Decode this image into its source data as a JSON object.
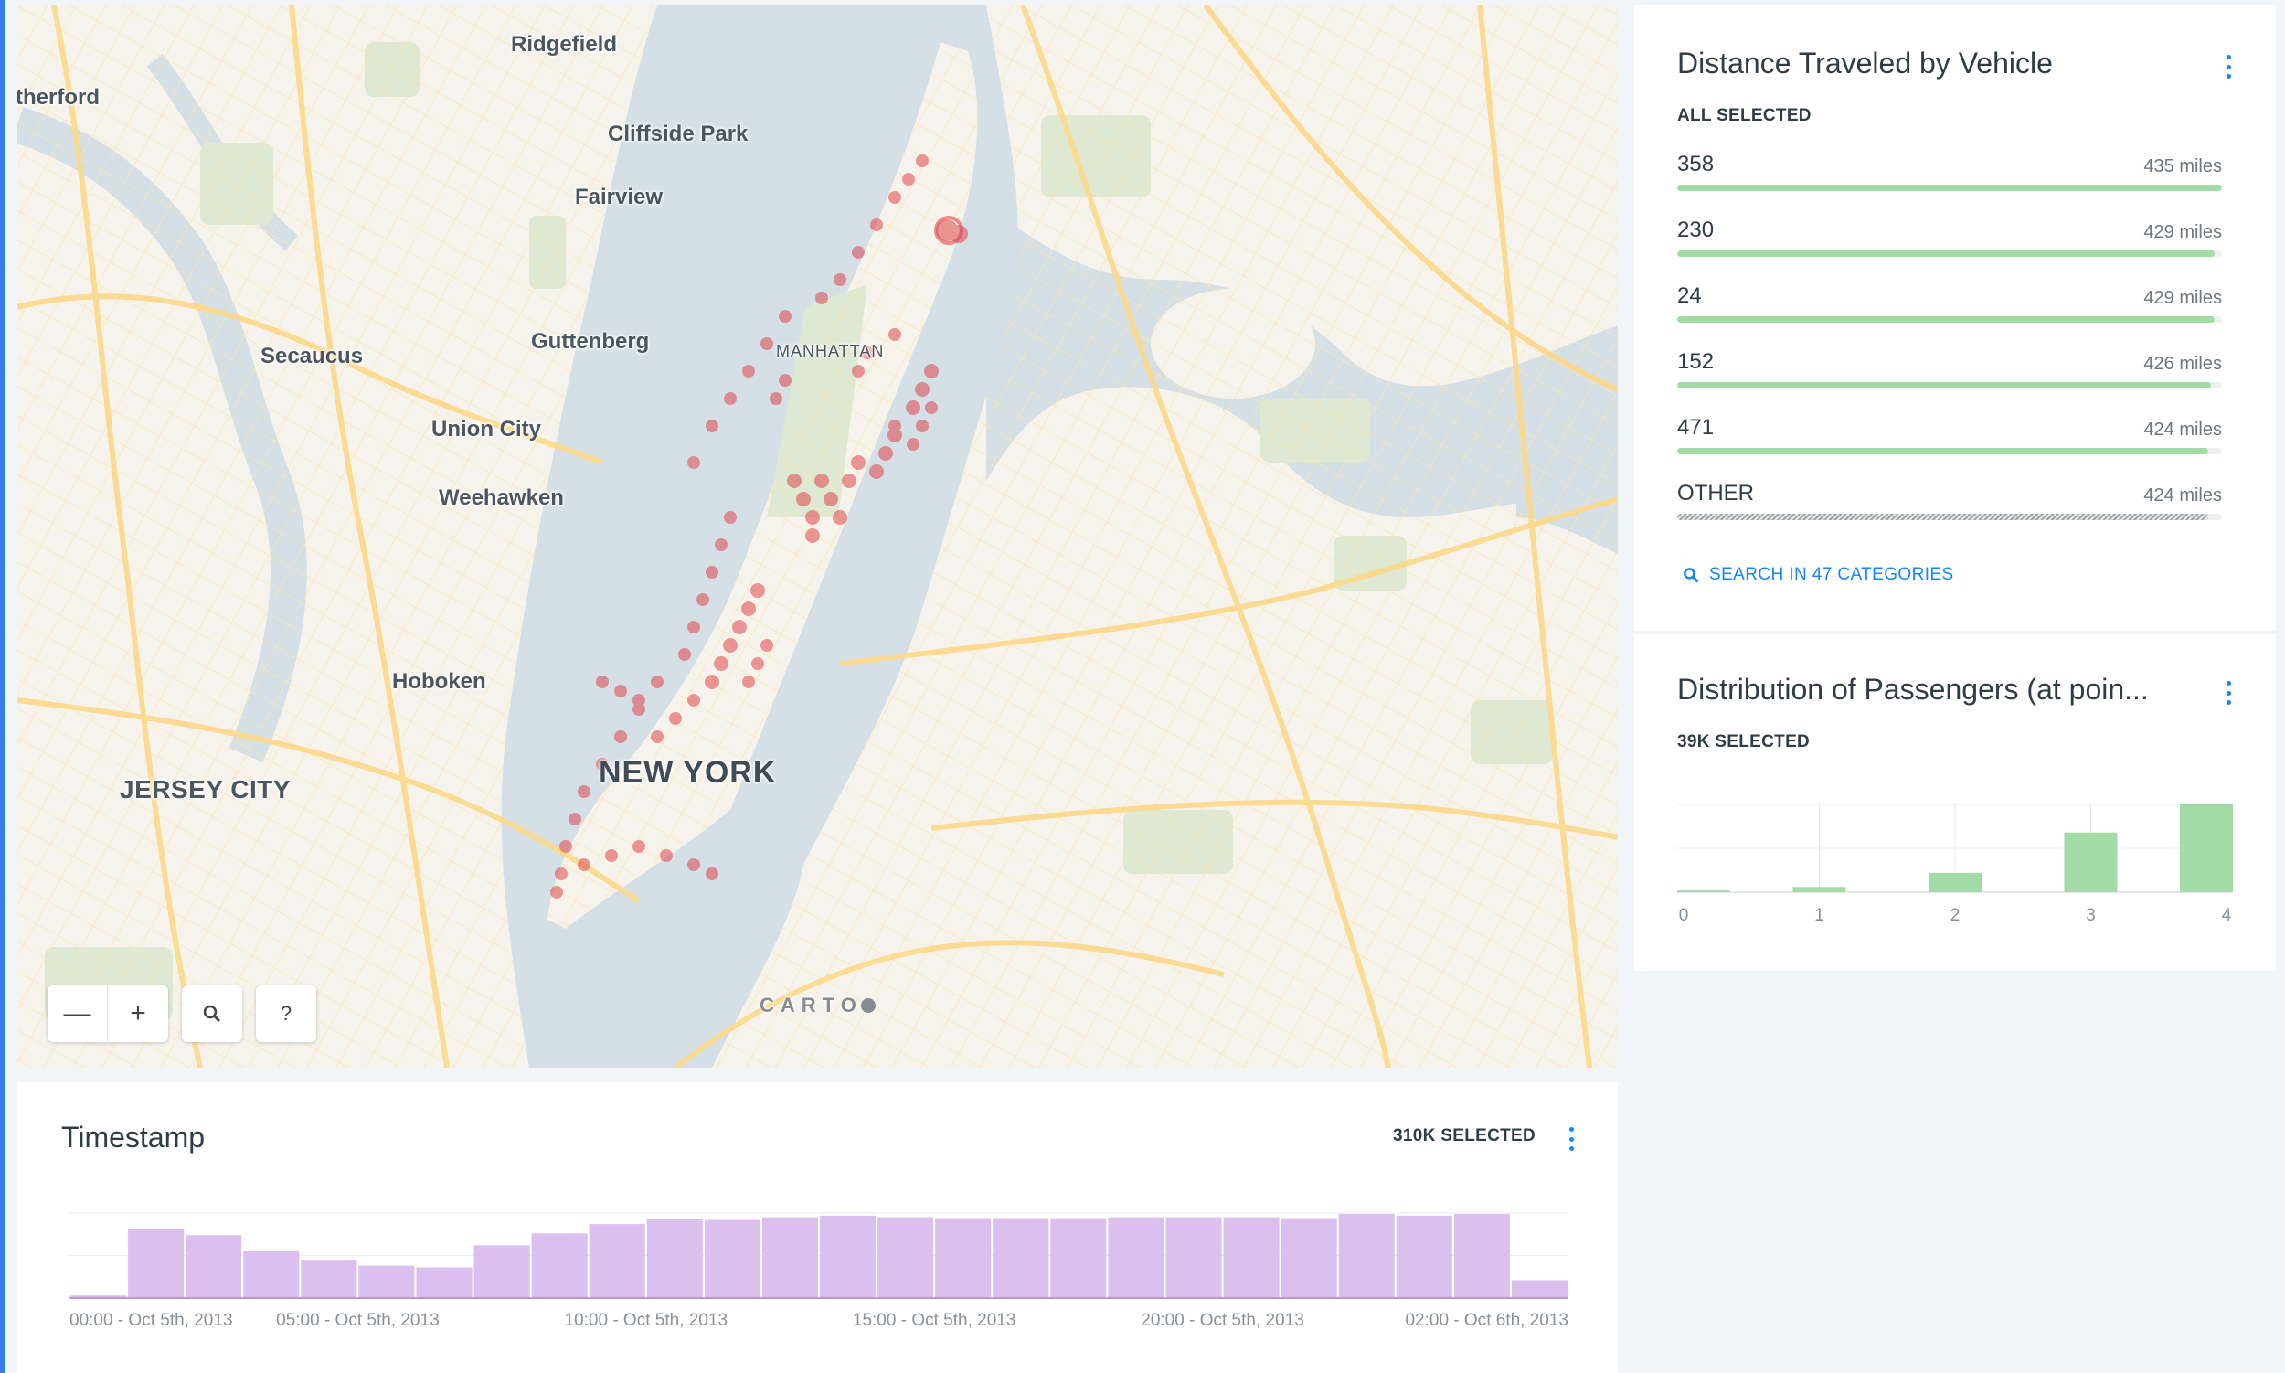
{
  "map": {
    "places": {
      "rutherford": "therford",
      "ridgefield": "Ridgefield",
      "cliffside_park": "Cliffside Park",
      "fairview": "Fairview",
      "secaucus": "Secaucus",
      "guttenberg": "Guttenberg",
      "union_city": "Union City",
      "weehawken": "Weehawken",
      "hoboken": "Hoboken",
      "jersey_city": "JERSEY CITY",
      "new_york": "NEW YORK",
      "manhattan": "MANHATTAN"
    },
    "controls": {
      "zoom_out": "—",
      "zoom_in": "+",
      "search": "🔍",
      "help": "?"
    },
    "attribution": "CARTO",
    "colors": {
      "water": "#d4dfe6",
      "land": "#f6f3ec",
      "park": "#dde9d3",
      "road": "#fce8a8",
      "points": "#e0484c"
    }
  },
  "distance_widget": {
    "title": "Distance Traveled by Vehicle",
    "selection": "ALL SELECTED",
    "menu_icon": "vertical-dots-icon",
    "categories": [
      {
        "name": "358",
        "value_text": "435 miles",
        "value": 435
      },
      {
        "name": "230",
        "value_text": "429 miles",
        "value": 429
      },
      {
        "name": "24",
        "value_text": "429 miles",
        "value": 429
      },
      {
        "name": "152",
        "value_text": "426 miles",
        "value": 426
      },
      {
        "name": "471",
        "value_text": "424 miles",
        "value": 424
      },
      {
        "name": "OTHER",
        "value_text": "424 miles",
        "value": 424
      }
    ],
    "search_link": "SEARCH IN 47 CATEGORIES",
    "bar_color": "#a2dba6"
  },
  "passengers_widget": {
    "title": "Distribution of Passengers (at poin...",
    "selection": "39K SELECTED",
    "menu_icon": "vertical-dots-icon"
  },
  "timestamp_widget": {
    "title": "Timestamp",
    "selection": "310K SELECTED",
    "menu_icon": "vertical-dots-icon"
  },
  "chart_data": [
    {
      "type": "bar",
      "title": "Distribution of Passengers (at poin...",
      "ticks": [
        "0",
        "1",
        "2",
        "3",
        "4"
      ],
      "values": [
        2,
        6,
        22,
        68,
        100
      ],
      "ylim": [
        0,
        100
      ],
      "color": "#a2dba6",
      "grid": true
    },
    {
      "type": "bar",
      "title": "Timestamp",
      "tick_labels": [
        "00:00 - Oct 5th, 2013",
        "05:00 - Oct 5th, 2013",
        "10:00 - Oct 5th, 2013",
        "15:00 - Oct 5th, 2013",
        "20:00 - Oct 5th, 2013",
        "02:00 - Oct 6th, 2013"
      ],
      "values": [
        3,
        81,
        74,
        56,
        45,
        38,
        36,
        62,
        76,
        87,
        93,
        92,
        95,
        97,
        95,
        94,
        94,
        94,
        95,
        95,
        95,
        94,
        99,
        97,
        99,
        21
      ],
      "ylim": [
        0,
        100
      ],
      "color": "#dbbfee",
      "grid": true
    }
  ]
}
